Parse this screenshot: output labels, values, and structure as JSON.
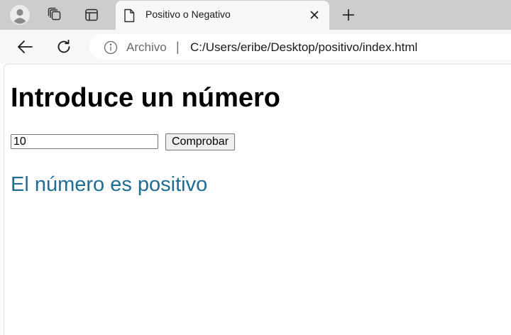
{
  "browser": {
    "tab": {
      "title": "Positivo o Negativo"
    },
    "address_bar": {
      "site_label": "Archivo",
      "separator": "|",
      "url": "C:/Users/eribe/Desktop/positivo/index.html"
    }
  },
  "page": {
    "heading": "Introduce un número",
    "input": {
      "value": "10"
    },
    "button_label": "Comprobar",
    "result_text": "El número es positivo"
  },
  "colors": {
    "tabstrip_bg": "#cdcdcd",
    "toolbar_bg": "#f7f7f7",
    "result_text": "#1f6d95"
  },
  "icons": {
    "profile": "profile-avatar-icon",
    "workspaces": "workspaces-icon",
    "tab_actions": "tab-actions-icon",
    "favicon": "document-icon",
    "close_tab": "close-icon",
    "new_tab": "plus-icon",
    "back": "back-arrow-icon",
    "reload": "reload-icon",
    "info": "info-icon"
  }
}
